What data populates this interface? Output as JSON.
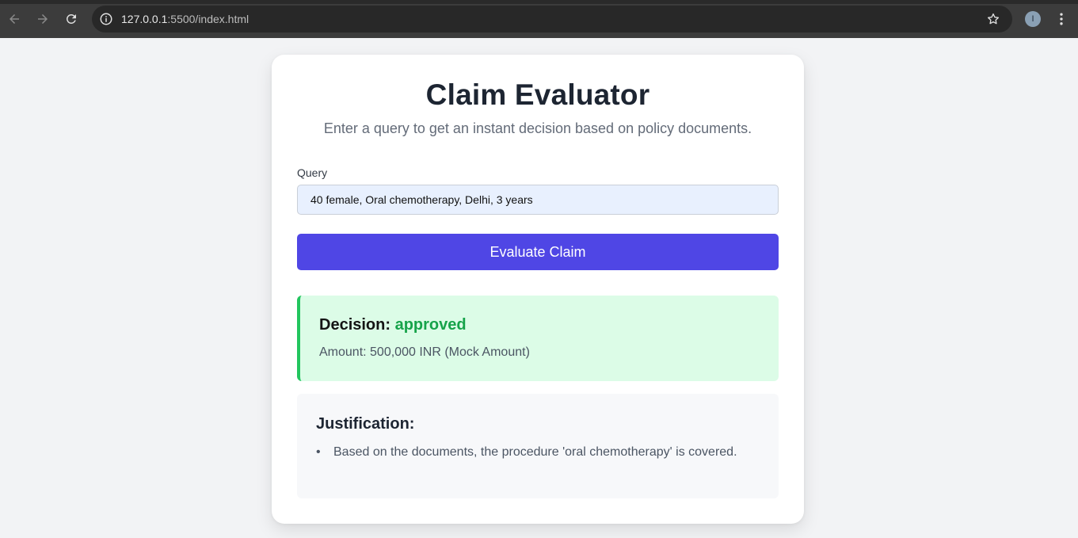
{
  "browser": {
    "url_host": "127.0.0.1",
    "url_path": ":5500/index.html",
    "profile_initial": "I",
    "icons": {
      "back": "arrow-left-icon",
      "forward": "arrow-right-icon",
      "reload": "reload-icon",
      "site_info": "info-icon",
      "bookmark": "star-icon",
      "menu": "kebab-menu-icon"
    }
  },
  "page": {
    "title": "Claim Evaluator",
    "subtitle": "Enter a query to get an instant decision based on policy documents.",
    "query_label": "Query",
    "query_value": "40 female, Oral chemotherapy, Delhi, 3 years",
    "button_label": "Evaluate Claim"
  },
  "result": {
    "decision_label": "Decision:",
    "decision_value": "approved",
    "amount_text": "Amount: 500,000 INR (Mock Amount)",
    "justification_heading": "Justification:",
    "justification_items": [
      "Based on the documents, the procedure 'oral chemotherapy' is covered."
    ]
  },
  "colors": {
    "accent": "#4f46e5",
    "approved": "#16a34a",
    "approved_bg": "#dcfce7",
    "approved_border": "#22c55e"
  }
}
